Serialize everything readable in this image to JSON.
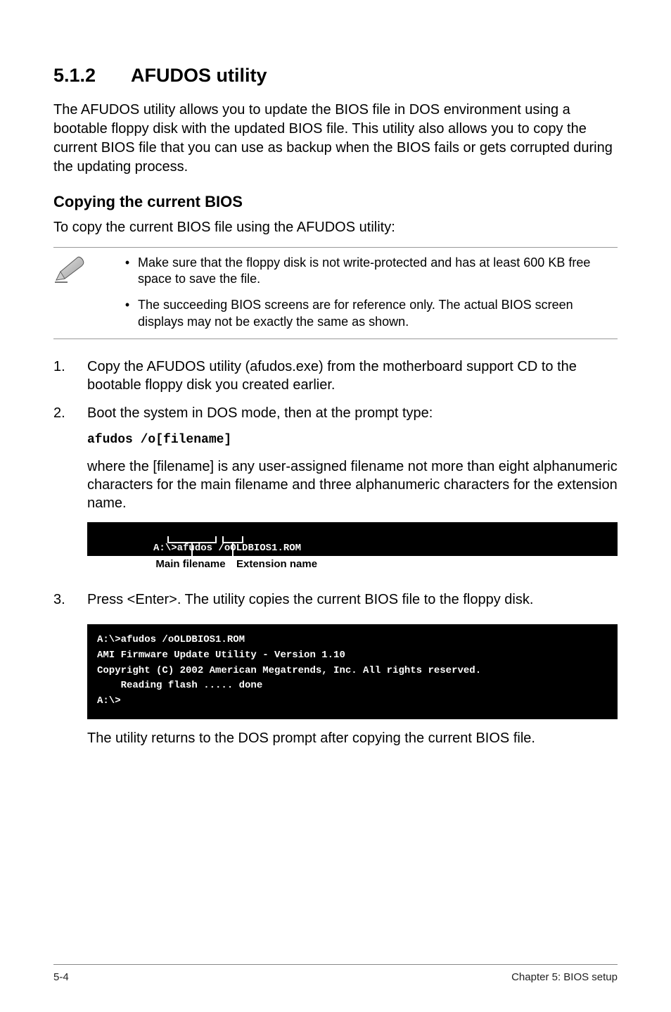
{
  "section": {
    "number": "5.1.2",
    "title": "AFUDOS utility"
  },
  "intro": "The AFUDOS utility allows you to update the BIOS file in DOS environment using a bootable floppy disk with the updated BIOS file. This utility also allows you to copy the current BIOS file that you can use as backup when the BIOS fails or gets corrupted during the updating process.",
  "subhead": "Copying the current BIOS",
  "subintro": "To copy the current BIOS file using the AFUDOS utility:",
  "callout": {
    "items": [
      "Make sure that the floppy disk is not write-protected and has at least 600 KB free space to save the file.",
      "The succeeding BIOS screens are for reference only. The actual BIOS screen displays may not be exactly the same as shown."
    ]
  },
  "steps": [
    {
      "n": "1.",
      "text": "Copy the AFUDOS utility (afudos.exe) from the motherboard support CD to the bootable floppy disk you created earlier."
    },
    {
      "n": "2.",
      "text": "Boot the system in DOS mode, then at the prompt type:"
    }
  ],
  "code_cmd": "afudos /o[filename]",
  "step2_note": "where the [filename] is any user-assigned filename not more than eight alphanumeric characters  for the main filename and three alphanumeric characters for the extension name.",
  "term1_line": "A:\\>afudos /oOLDBIOS1.ROM",
  "label_main": "Main filename",
  "label_ext": "Extension name",
  "step3": {
    "n": "3.",
    "text": "Press <Enter>. The utility copies the current BIOS file to the floppy disk."
  },
  "term2_lines": "A:\\>afudos /oOLDBIOS1.ROM\nAMI Firmware Update Utility - Version 1.10\nCopyright (C) 2002 American Megatrends, Inc. All rights reserved.\n    Reading flash ..... done\nA:\\>",
  "after_term2": "The utility returns to the DOS prompt after copying the current BIOS file.",
  "footer": {
    "left": "5-4",
    "right": "Chapter 5: BIOS setup"
  }
}
